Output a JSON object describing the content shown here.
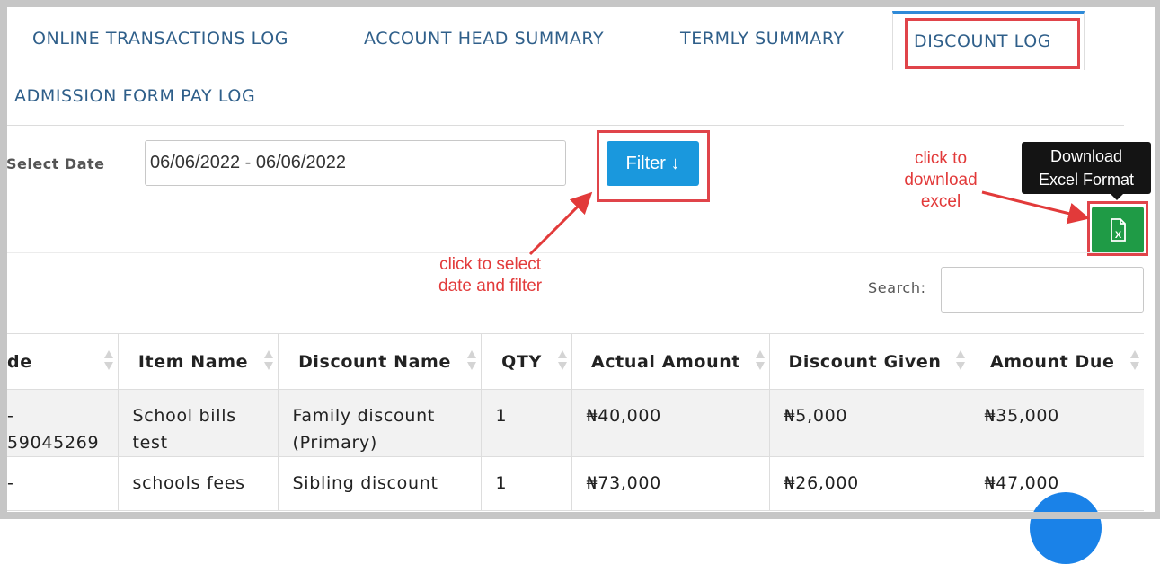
{
  "tabs": [
    {
      "label": "ONLINE TRANSACTIONS LOG"
    },
    {
      "label": "ACCOUNT HEAD SUMMARY"
    },
    {
      "label": "TERMLY SUMMARY"
    },
    {
      "label": "DISCOUNT LOG",
      "active": true
    },
    {
      "label": "ADMISSION FORM PAY LOG"
    }
  ],
  "filters": {
    "date_label": "Select Date",
    "date_value": "06/06/2022 - 06/06/2022",
    "filter_button": "Filter ↓",
    "excel_icon": "excel-file-icon",
    "tooltip_line1": "Download",
    "tooltip_line2": "Excel Format"
  },
  "annotations": {
    "filter_line1": "click to select",
    "filter_line2": "date and filter",
    "excel_line1": "click to",
    "excel_line2": "download",
    "excel_line3": "excel"
  },
  "search": {
    "label": "Search:",
    "value": ""
  },
  "table": {
    "columns": [
      "de",
      "Item Name",
      "Discount Name",
      "QTY",
      "Actual Amount",
      "Discount Given",
      "Amount Due"
    ],
    "rows": [
      {
        "code_line1": "-",
        "code_line2": "59045269",
        "item_line1": "School bills",
        "item_line2": "test",
        "discount_line1": "Family discount",
        "discount_line2": "(Primary)",
        "qty": "1",
        "actual": "₦40,000",
        "given": "₦5,000",
        "due": "₦35,000"
      },
      {
        "code_line1": "-",
        "code_line2": "",
        "item_line1": "schools fees",
        "item_line2": "",
        "discount_line1": "Sibling discount",
        "discount_line2": "",
        "qty": "1",
        "actual": "₦73,000",
        "given": "₦26,000",
        "due": "₦47,000"
      }
    ]
  },
  "colors": {
    "accent": "#1a98dd",
    "excel": "#1f9b46",
    "annotation": "#e23a3a",
    "tab_text": "#2f5f8a"
  }
}
